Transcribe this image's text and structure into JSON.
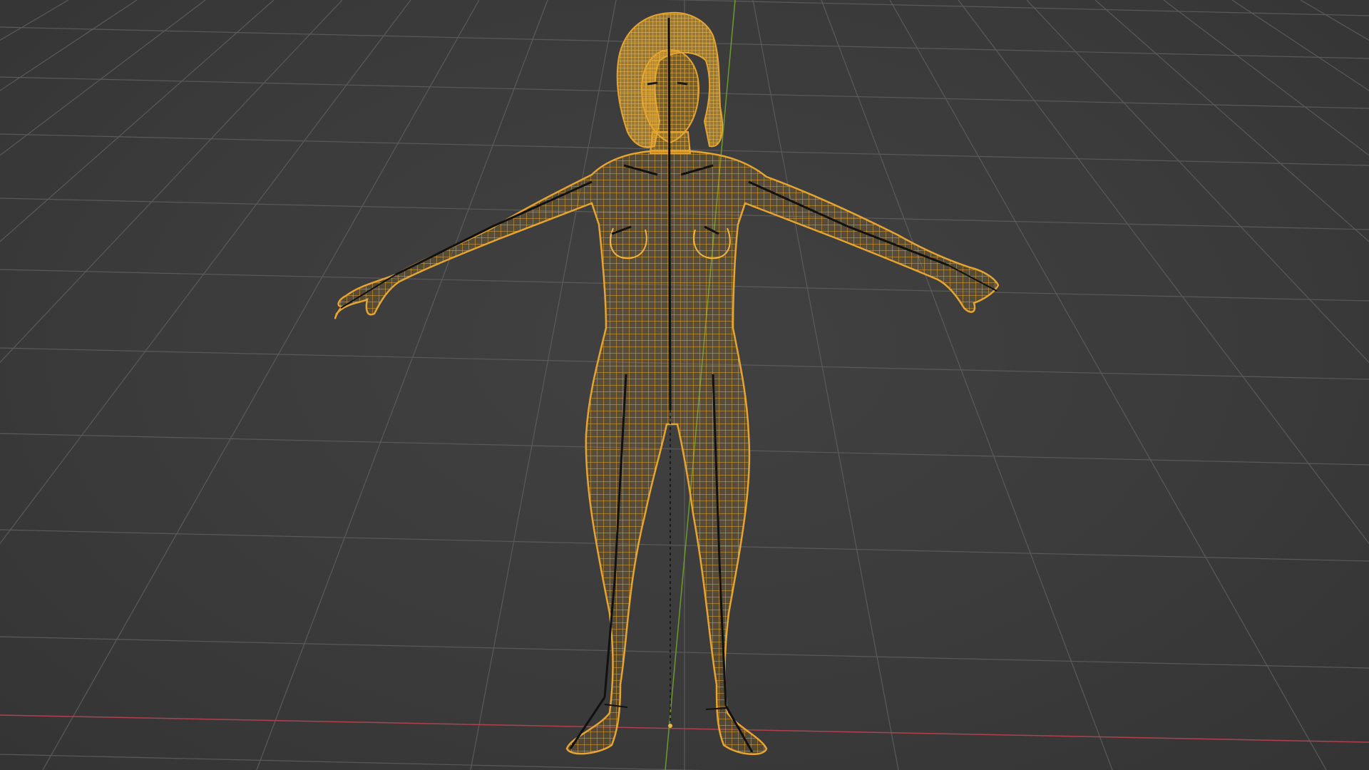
{
  "viewport": {
    "background_color": "#3d3d3d",
    "grid_color": "#5a5a5a",
    "x_axis_color": "#b0414e",
    "y_axis_color": "#6a9b2c",
    "mesh_color": "#e6a430",
    "bone_color": "#111111",
    "display_mode": "wireframe",
    "selected_object": "human-mesh-with-armature"
  }
}
